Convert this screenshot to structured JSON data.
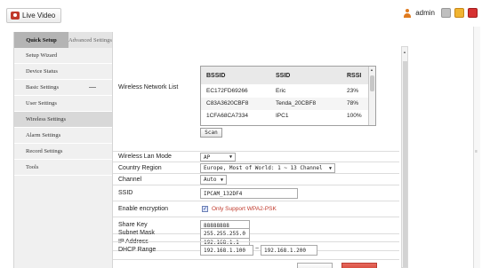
{
  "header": {
    "live_video_label": "Live Video",
    "username": "admin"
  },
  "sidebar": {
    "tabs": [
      {
        "label": "Quick Setup"
      },
      {
        "label": "Advanced Settings"
      }
    ],
    "items": [
      {
        "label": "Setup Wizard"
      },
      {
        "label": "Device Status"
      },
      {
        "label": "Basic Settings"
      },
      {
        "label": "User Settings"
      },
      {
        "label": "Wireless Settings"
      },
      {
        "label": "Alarm Settings"
      },
      {
        "label": "Record Settings"
      },
      {
        "label": "Tools"
      }
    ]
  },
  "wireless": {
    "network_list_label": "Wireless Network List",
    "columns": [
      "BSSID",
      "SSID",
      "RSSI"
    ],
    "networks": [
      {
        "bssid": "EC172FD69266",
        "ssid": "Eric",
        "rssi": "23%"
      },
      {
        "bssid": "C83A3620CBF8",
        "ssid": "Tenda_20CBF8",
        "rssi": "78%"
      },
      {
        "bssid": "1CFA68CA7334",
        "ssid": "IPC1",
        "rssi": "100%"
      }
    ],
    "scan_button": "Scan",
    "fields": {
      "mode": {
        "label": "Wireless Lan Mode",
        "value": "AP"
      },
      "region": {
        "label": "Country Region",
        "value": "Europe, Most of World: 1 ~ 13 Channel"
      },
      "channel": {
        "label": "Channel",
        "value": "Auto"
      },
      "ssid": {
        "label": "SSID",
        "value": "IPCAM_132DF4"
      },
      "encryption": {
        "label": "Enable encryption",
        "note": "Only Support WPA2-PSK",
        "checked": true
      },
      "share_key": {
        "label": "Share Key",
        "value": "88888888"
      },
      "ip_address": {
        "label": "IP Address",
        "value": "192.168.1.1"
      },
      "subnet_mask": {
        "label": "Subnet Mask",
        "value": "255.255.255.0"
      },
      "dhcp_range": {
        "label": "DHCP Range",
        "start": "192.168.1.100",
        "separator": "~",
        "end": "192.168.1.200"
      }
    }
  },
  "colors": {
    "accent_red": "#c0392b",
    "sidebar_active": "#b4b4b4"
  },
  "icons": {
    "live_video": "camera-icon",
    "user": "user-icon",
    "language": "language-icon",
    "folder": "folder-icon",
    "exit": "exit-icon"
  }
}
